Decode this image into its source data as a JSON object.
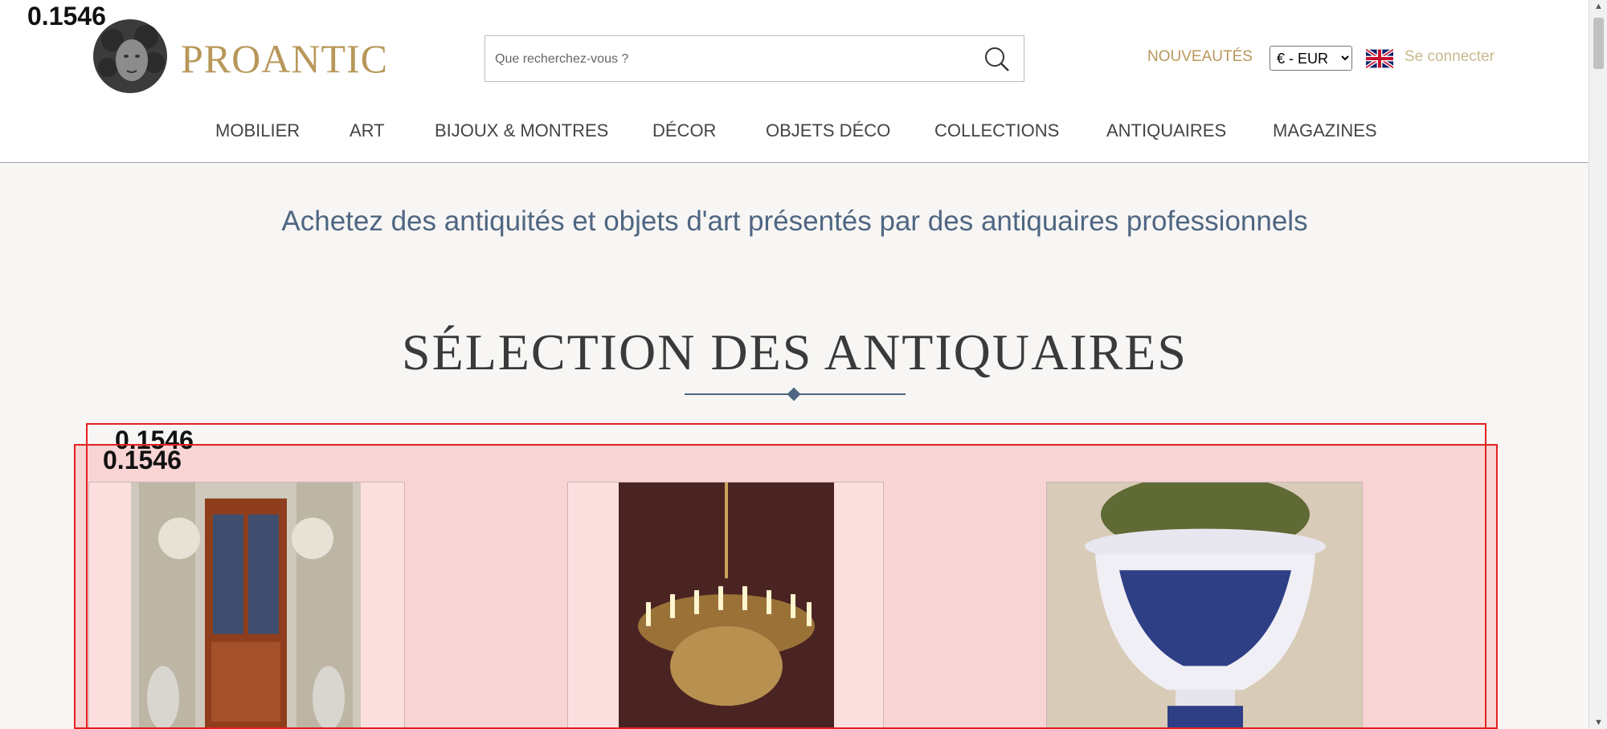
{
  "header": {
    "logo_text": "PROANTIC",
    "search": {
      "placeholder": "Que recherchez-vous ?",
      "value": ""
    },
    "nouveautes_label": "NOUVEAUTÉS",
    "currency": {
      "selected": "€ - EUR"
    },
    "login_label": "Se connecter"
  },
  "nav": {
    "items": [
      {
        "label": "MOBILIER"
      },
      {
        "label": "ART"
      },
      {
        "label": "BIJOUX & MONTRES"
      },
      {
        "label": "DÉCOR"
      },
      {
        "label": "OBJETS DÉCO"
      },
      {
        "label": "COLLECTIONS"
      },
      {
        "label": "ANTIQUAIRES"
      },
      {
        "label": "MAGAZINES"
      }
    ]
  },
  "main": {
    "tagline": "Achetez des antiquités et objets d'art présentés par des antiquaires professionnels",
    "section_title": "SÉLECTION DES ANTIQUAIRES",
    "products": [
      {
        "icon": "cabinet-image"
      },
      {
        "icon": "chandelier-image"
      },
      {
        "icon": "vase-image"
      }
    ]
  },
  "overlay_labels": {
    "top_left": "0.1546",
    "box_a": "0.1546",
    "box_b": "0.1546"
  },
  "colors": {
    "brand_gold": "#b8975a",
    "accent_blue": "#4f6682",
    "selection_highlight": "#f9d4d4",
    "debug_red": "#e52020"
  }
}
